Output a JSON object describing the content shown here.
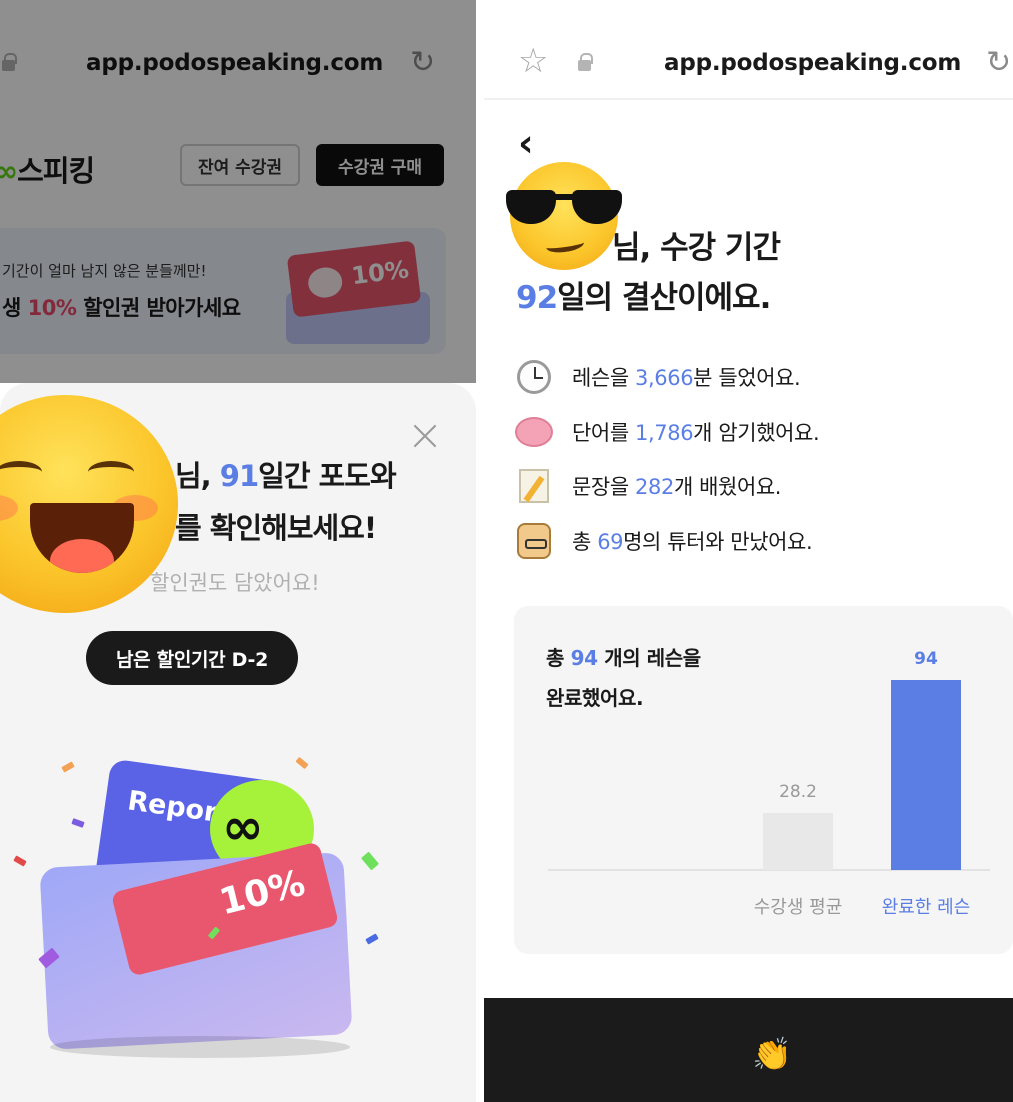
{
  "left": {
    "url": "app.podospeaking.com",
    "logo": {
      "mark": "∞",
      "text": "스피킹"
    },
    "header_buttons": {
      "remain_label": "잔여 수강권",
      "buy_label": "수강권 구매"
    },
    "promo": {
      "line1": "기간이 얼마 남지 않은 분들께만!",
      "line2_pre": "생 ",
      "line2_pct": "10%",
      "line2_post": " 할인권 받아가세요",
      "ticket_text": "10%"
    },
    "sheet": {
      "title1_pre": "님, ",
      "title1_num": "91",
      "title1_post": "일간 포도와",
      "title2": "를 확인해보세요!",
      "subtitle": "할인권도 담았어요!",
      "dday_button": "남은 할인기간 D-2"
    },
    "illustration": {
      "card_text": "Report",
      "ticket_text": "10%",
      "coin_mark": "∞"
    }
  },
  "right": {
    "url": "app.podospeaking.com",
    "title1": "님, 수강 기간",
    "title2_num": "92",
    "title2_post": "일의 결산이에요.",
    "stats": [
      {
        "icon": "clock-icon",
        "pre": "레슨을 ",
        "num": "3,666",
        "post": "분 들었어요."
      },
      {
        "icon": "brain-icon",
        "pre": "단어를 ",
        "num": "1,786",
        "post": "개 암기했어요."
      },
      {
        "icon": "memo-icon",
        "pre": "문장을 ",
        "num": "282",
        "post": "개 배웠어요."
      },
      {
        "icon": "teacher-icon",
        "pre": "총 ",
        "num": "69",
        "post": "명의 튜터와 만났어요."
      }
    ],
    "summary_pre": "총 ",
    "summary_num": "94",
    "summary_post": " 개의 레슨을",
    "summary_line2": "완료했어요.",
    "bottom_icon": "clapping-hands-icon",
    "bottom_glyph": "👏"
  },
  "chart_data": {
    "type": "bar",
    "categories": [
      "수강생 평균",
      "완료한 레슨"
    ],
    "values": [
      28.2,
      94
    ],
    "data_labels": [
      "28.2",
      "94"
    ],
    "colors": [
      "#e8e8e8",
      "#5b7ee5"
    ],
    "label_colors": [
      "#999999",
      "#5b7ee5"
    ],
    "ylim": [
      0,
      94
    ]
  }
}
